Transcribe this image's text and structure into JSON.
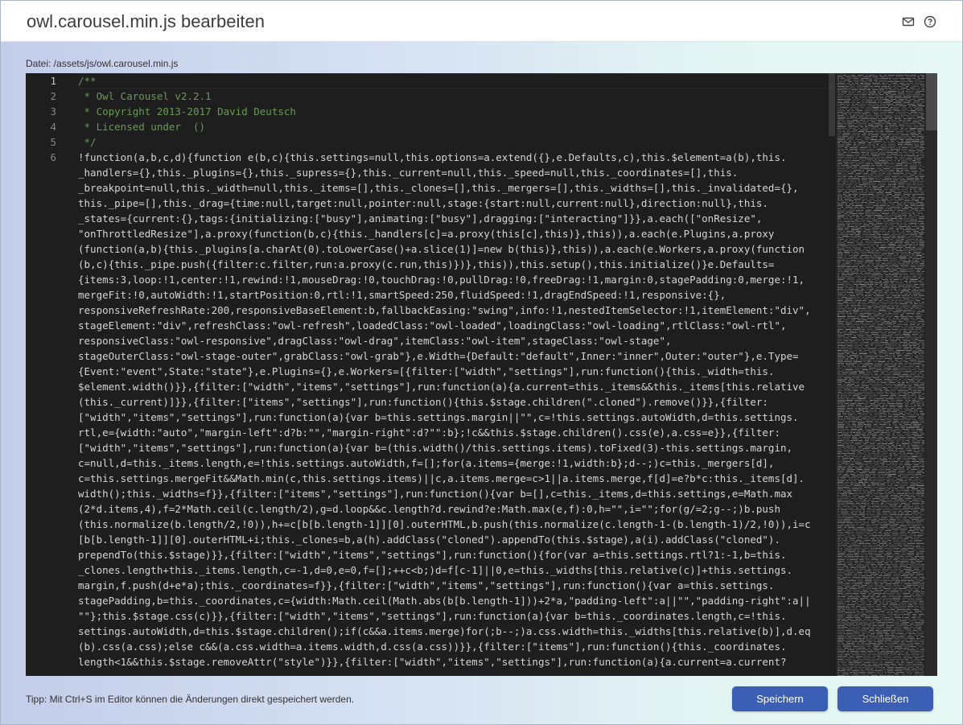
{
  "window": {
    "title": "owl.carousel.min.js bearbeiten",
    "icons": [
      "mail-icon",
      "help-icon"
    ]
  },
  "editor": {
    "file_label": "Datei: /assets/js/owl.carousel.min.js",
    "line_numbers": [
      "1",
      "2",
      "3",
      "4",
      "5",
      "6"
    ],
    "lines": [
      "/**",
      " * Owl Carousel v2.2.1",
      " * Copyright 2013-2017 David Deutsch",
      " * Licensed under  ()",
      " */",
      "!function(a,b,c,d){function e(b,c){this.settings=null,this.options=a.extend({},e.Defaults,c),this.$element=a(b),this.",
      "_handlers={},this._plugins={},this._supress={},this._current=null,this._speed=null,this._coordinates=[],this.",
      "_breakpoint=null,this._width=null,this._items=[],this._clones=[],this._mergers=[],this._widths=[],this._invalidated={},",
      "this._pipe=[],this._drag={time:null,target:null,pointer:null,stage:{start:null,current:null},direction:null},this.",
      "_states={current:{},tags:{initializing:[\"busy\"],animating:[\"busy\"],dragging:[\"interacting\"]}},a.each([\"onResize\",",
      "\"onThrottledResize\"],a.proxy(function(b,c){this._handlers[c]=a.proxy(this[c],this)},this)),a.each(e.Plugins,a.proxy",
      "(function(a,b){this._plugins[a.charAt(0).toLowerCase()+a.slice(1)]=new b(this)},this)),a.each(e.Workers,a.proxy(function",
      "(b,c){this._pipe.push({filter:c.filter,run:a.proxy(c.run,this)})},this)),this.setup(),this.initialize()}e.Defaults=",
      "{items:3,loop:!1,center:!1,rewind:!1,mouseDrag:!0,touchDrag:!0,pullDrag:!0,freeDrag:!1,margin:0,stagePadding:0,merge:!1,",
      "mergeFit:!0,autoWidth:!1,startPosition:0,rtl:!1,smartSpeed:250,fluidSpeed:!1,dragEndSpeed:!1,responsive:{},",
      "responsiveRefreshRate:200,responsiveBaseElement:b,fallbackEasing:\"swing\",info:!1,nestedItemSelector:!1,itemElement:\"div\",",
      "stageElement:\"div\",refreshClass:\"owl-refresh\",loadedClass:\"owl-loaded\",loadingClass:\"owl-loading\",rtlClass:\"owl-rtl\",",
      "responsiveClass:\"owl-responsive\",dragClass:\"owl-drag\",itemClass:\"owl-item\",stageClass:\"owl-stage\",",
      "stageOuterClass:\"owl-stage-outer\",grabClass:\"owl-grab\"},e.Width={Default:\"default\",Inner:\"inner\",Outer:\"outer\"},e.Type=",
      "{Event:\"event\",State:\"state\"},e.Plugins={},e.Workers=[{filter:[\"width\",\"settings\"],run:function(){this._width=this.",
      "$element.width()}},{filter:[\"width\",\"items\",\"settings\"],run:function(a){a.current=this._items&&this._items[this.relative",
      "(this._current)]}},{filter:[\"items\",\"settings\"],run:function(){this.$stage.children(\".cloned\").remove()}},{filter:",
      "[\"width\",\"items\",\"settings\"],run:function(a){var b=this.settings.margin||\"\",c=!this.settings.autoWidth,d=this.settings.",
      "rtl,e={width:\"auto\",\"margin-left\":d?b:\"\",\"margin-right\":d?\"\":b};!c&&this.$stage.children().css(e),a.css=e}},{filter:",
      "[\"width\",\"items\",\"settings\"],run:function(a){var b=(this.width()/this.settings.items).toFixed(3)-this.settings.margin,",
      "c=null,d=this._items.length,e=!this.settings.autoWidth,f=[];for(a.items={merge:!1,width:b};d--;)c=this._mergers[d],",
      "c=this.settings.mergeFit&&Math.min(c,this.settings.items)||c,a.items.merge=c>1||a.items.merge,f[d]=e?b*c:this._items[d].",
      "width();this._widths=f}},{filter:[\"items\",\"settings\"],run:function(){var b=[],c=this._items,d=this.settings,e=Math.max",
      "(2*d.items,4),f=2*Math.ceil(c.length/2),g=d.loop&&c.length?d.rewind?e:Math.max(e,f):0,h=\"\",i=\"\";for(g/=2;g--;)b.push",
      "(this.normalize(b.length/2,!0)),h+=c[b[b.length-1]][0].outerHTML,b.push(this.normalize(c.length-1-(b.length-1)/2,!0)),i=c",
      "[b[b.length-1]][0].outerHTML+i;this._clones=b,a(h).addClass(\"cloned\").appendTo(this.$stage),a(i).addClass(\"cloned\").",
      "prependTo(this.$stage)}},{filter:[\"width\",\"items\",\"settings\"],run:function(){for(var a=this.settings.rtl?1:-1,b=this.",
      "_clones.length+this._items.length,c=-1,d=0,e=0,f=[];++c<b;)d=f[c-1]||0,e=this._widths[this.relative(c)]+this.settings.",
      "margin,f.push(d+e*a);this._coordinates=f}},{filter:[\"width\",\"items\",\"settings\"],run:function(){var a=this.settings.",
      "stagePadding,b=this._coordinates,c={width:Math.ceil(Math.abs(b[b.length-1]))+2*a,\"padding-left\":a||\"\",\"padding-right\":a||",
      "\"\"};this.$stage.css(c)}},{filter:[\"width\",\"items\",\"settings\"],run:function(a){var b=this._coordinates.length,c=!this.",
      "settings.autoWidth,d=this.$stage.children();if(c&&a.items.merge)for(;b--;)a.css.width=this._widths[this.relative(b)],d.eq",
      "(b).css(a.css);else c&&(a.css.width=a.items.width,d.css(a.css))}},{filter:[\"items\"],run:function(){this._coordinates.",
      "length<1&&this.$stage.removeAttr(\"style\")}},{filter:[\"width\",\"items\",\"settings\"],run:function(a){a.current=a.current?"
    ]
  },
  "footer": {
    "tip": "Tipp: Mit Ctrl+S im Editor können die Änderungen direkt gespeichert werden.",
    "save_label": "Speichern",
    "close_label": "Schließen"
  },
  "colors": {
    "button": "#3b5fb4",
    "editor_bg": "#1e1e1e",
    "comment": "#6a9955"
  }
}
